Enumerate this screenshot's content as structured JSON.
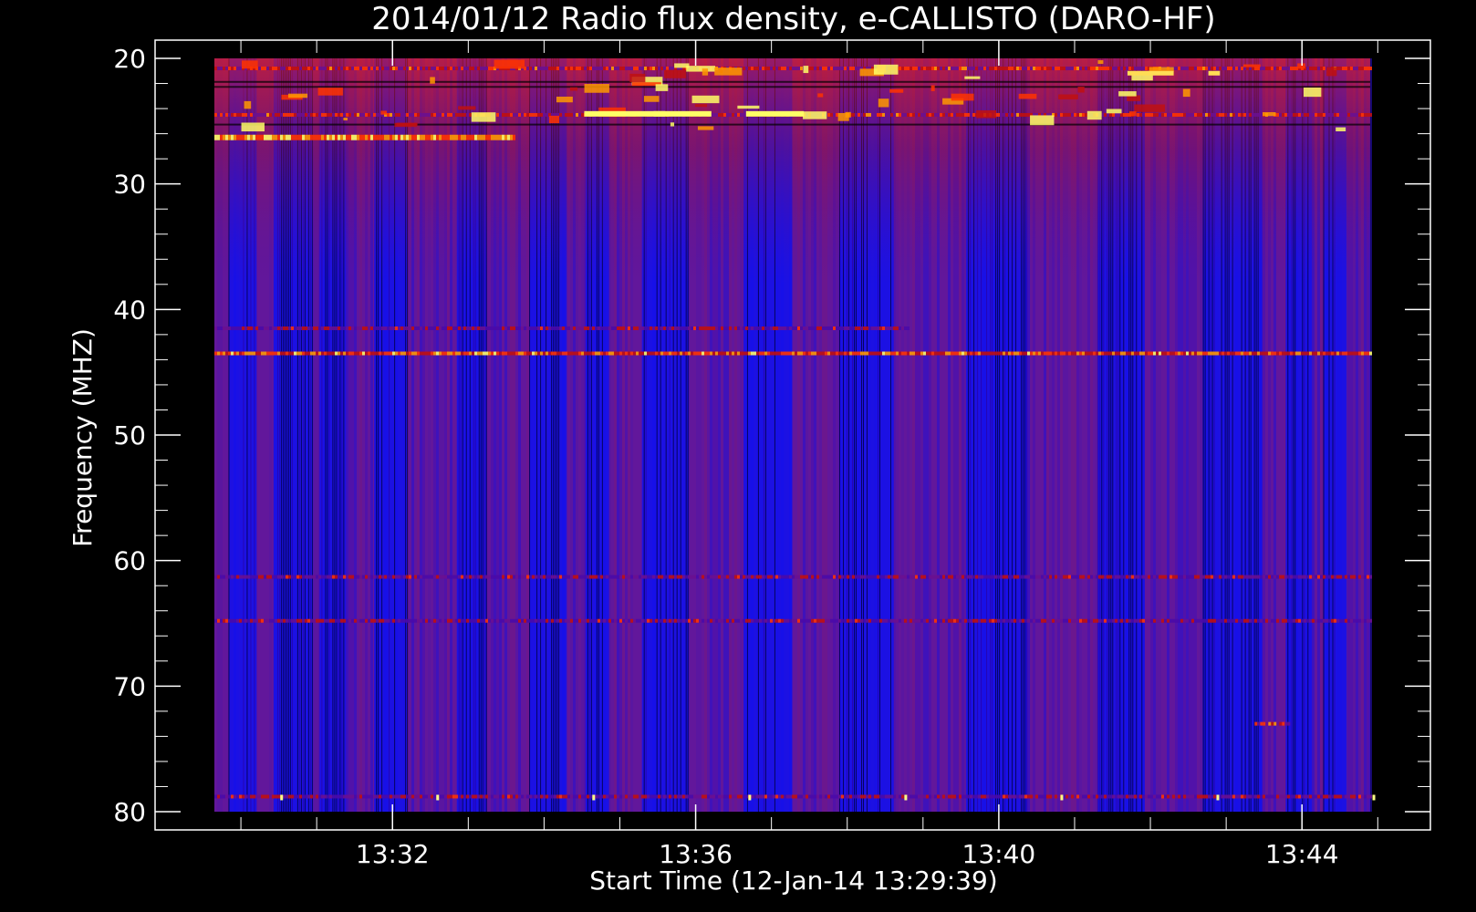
{
  "chart_data": {
    "type": "heatmap",
    "title": "2014/01/12  Radio flux density, e-CALLISTO (DARO-HF)",
    "xlabel": "Start Time (12-Jan-14 13:29:39)",
    "ylabel": "Frequency (MHZ)",
    "x_ticks": [
      "13:32",
      "13:36",
      "13:40",
      "13:44"
    ],
    "x_tick_minutes": [
      152.35,
      392.35,
      632.35,
      872.35
    ],
    "xlim_seconds_from_start": [
      0,
      915
    ],
    "y_ticks": [
      20,
      30,
      40,
      50,
      60,
      70,
      80
    ],
    "ylim": [
      20,
      80
    ],
    "y_axis_inverted": true,
    "colormap": [
      "#000000",
      "#0000ff",
      "#4a0aa8",
      "#6a1090",
      "#c01010",
      "#ff3300",
      "#ff9900",
      "#ffff66"
    ],
    "background_color": "#000000",
    "axis_color": "#ffffff",
    "dark_bands_seconds": [
      [
        15,
        45
      ],
      [
        63,
        105
      ],
      [
        112,
        140
      ],
      [
        170,
        205
      ],
      [
        258,
        290
      ],
      [
        335,
        375
      ],
      [
        395,
        420
      ],
      [
        455,
        505
      ],
      [
        563,
        615
      ],
      [
        665,
        723
      ],
      [
        800,
        865
      ],
      [
        940,
        990
      ],
      [
        1052,
        1115
      ],
      [
        1140,
        1168
      ],
      [
        1180,
        1205
      ]
    ],
    "emission_lines": [
      {
        "freq": 20.8,
        "from": 0,
        "to": 1,
        "level": 5
      },
      {
        "freq": 24.5,
        "from": 0,
        "to": 1,
        "level": 5
      },
      {
        "freq": 26.3,
        "from": 0,
        "to": 0.26,
        "level": 7
      },
      {
        "freq": 43.5,
        "from": 0,
        "to": 1,
        "level": 6
      },
      {
        "freq": 41.5,
        "from": 0,
        "to": 0.6,
        "level": 4
      },
      {
        "freq": 61.3,
        "from": 0,
        "to": 1,
        "level": 4
      },
      {
        "freq": 64.8,
        "from": 0,
        "to": 1,
        "level": 4
      },
      {
        "freq": 73,
        "from": 0.9,
        "to": 0.93,
        "level": 5
      },
      {
        "freq": 78.8,
        "from": 0,
        "to": 1,
        "level": 4
      }
    ]
  }
}
